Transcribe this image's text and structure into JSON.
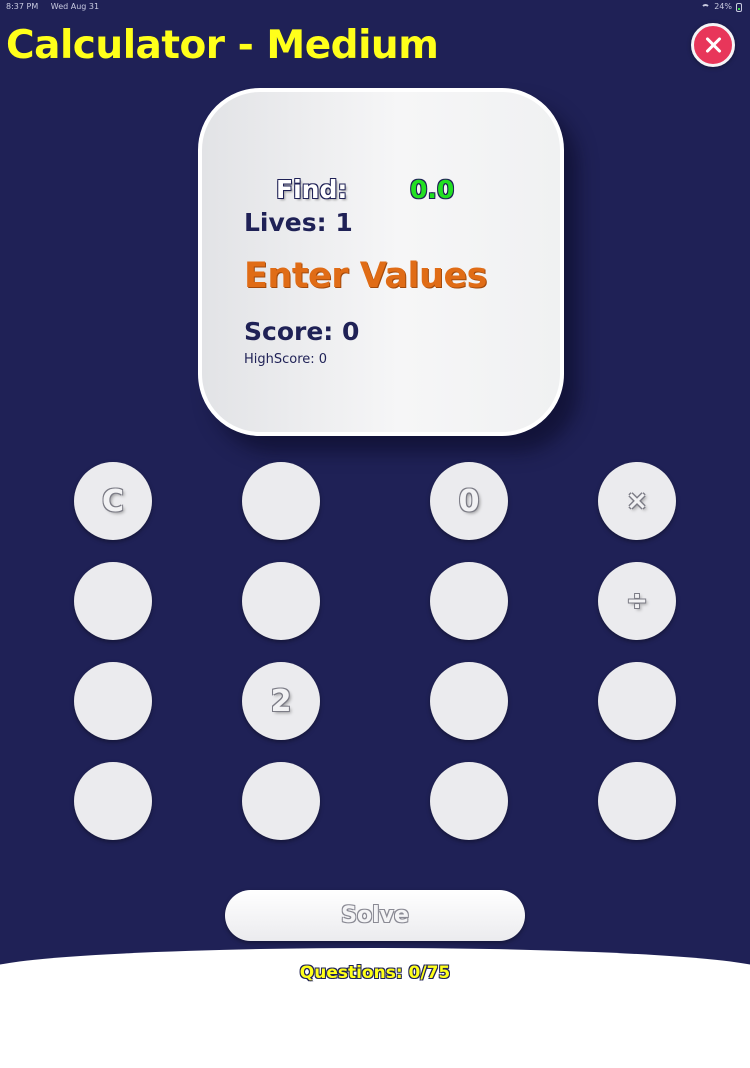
{
  "status_bar": {
    "time": "8:37 PM",
    "date": "Wed Aug 31",
    "battery": "24%"
  },
  "header": {
    "title": "Calculator - Medium",
    "close_icon": "close-icon"
  },
  "card": {
    "find_label": "Find:",
    "find_value": "0.0",
    "lives": "Lives: 1",
    "message": "Enter Values",
    "score": "Score: 0",
    "highscore": "HighScore: 0"
  },
  "keypad": {
    "rows": [
      [
        "C",
        "",
        "0",
        "×"
      ],
      [
        "",
        "",
        "",
        "÷"
      ],
      [
        "",
        "2",
        "",
        ""
      ],
      [
        "",
        "",
        "",
        ""
      ]
    ]
  },
  "solve_label": "Solve",
  "footer": {
    "questions": "Questions: 0/75"
  },
  "colors": {
    "background": "#1f2156",
    "title": "#ffff1a",
    "find_value": "#22e022",
    "message": "#e06c16",
    "close_button": "#e8365a"
  }
}
